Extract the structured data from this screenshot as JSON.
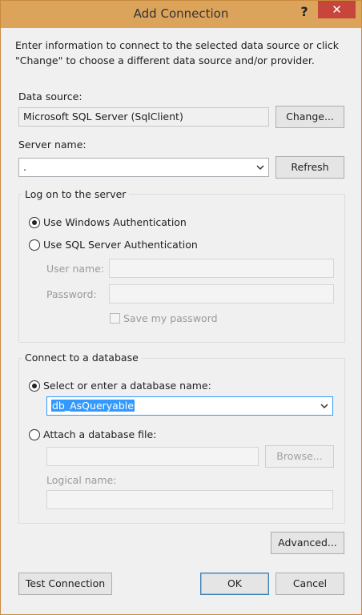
{
  "window": {
    "title": "Add Connection",
    "help_label": "?",
    "close_label": "✕"
  },
  "description": "Enter information to connect to the selected data source or click \"Change\" to choose a different data source and/or provider.",
  "data_source": {
    "label": "Data source:",
    "value": "Microsoft SQL Server (SqlClient)",
    "change_label": "Change..."
  },
  "server": {
    "label": "Server name:",
    "value": ".",
    "refresh_label": "Refresh"
  },
  "logon": {
    "group_title": "Log on to the server",
    "windows_auth_label": "Use Windows Authentication",
    "sql_auth_label": "Use SQL Server Authentication",
    "selected": "windows",
    "username_label": "User name:",
    "username_value": "",
    "password_label": "Password:",
    "password_value": "",
    "save_password_label": "Save my password",
    "save_password_checked": false
  },
  "database": {
    "group_title": "Connect to a database",
    "select_label": "Select or enter a database name:",
    "select_value": "db_AsQueryable",
    "attach_label": "Attach a database file:",
    "attach_value": "",
    "browse_label": "Browse...",
    "logical_name_label": "Logical name:",
    "logical_name_value": "",
    "selected": "select"
  },
  "buttons": {
    "advanced_label": "Advanced...",
    "test_label": "Test Connection",
    "ok_label": "OK",
    "cancel_label": "Cancel"
  },
  "colors": {
    "titlebar": "#dca45a",
    "close": "#c7453a",
    "selection": "#3399ff"
  }
}
